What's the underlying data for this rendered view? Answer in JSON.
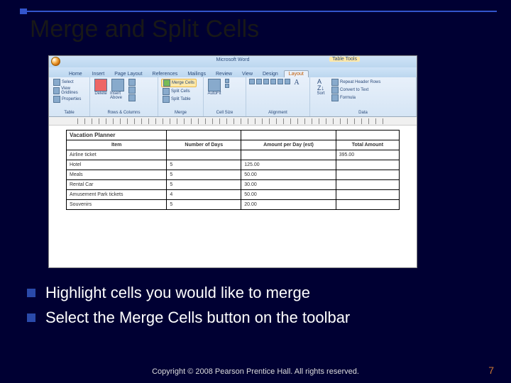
{
  "slide": {
    "title": "Merge and Split Cells",
    "bullets": [
      "Highlight cells you would like to merge",
      "Select the Merge Cells button on the toolbar"
    ],
    "copyright": "Copyright © 2008 Pearson Prentice Hall. All rights reserved.",
    "page_number": "7"
  },
  "word": {
    "app_title": "Microsoft Word",
    "context_tab_group": "Table Tools",
    "tabs": [
      "Home",
      "Insert",
      "Page Layout",
      "References",
      "Mailings",
      "Review",
      "View",
      "Design",
      "Layout"
    ],
    "active_tab": "Layout",
    "groups": {
      "table": {
        "label": "Table",
        "items": [
          "Select",
          "View Gridlines",
          "Properties"
        ]
      },
      "rows_columns": {
        "label": "Rows & Columns",
        "delete": "Delete",
        "insert_above": "Insert Above",
        "insert_below": "Insert Below",
        "insert_left": "Insert Left",
        "insert_right": "Insert Right"
      },
      "merge": {
        "label": "Merge",
        "merge_cells": "Merge Cells",
        "split_cells": "Split Cells",
        "split_table": "Split Table"
      },
      "cell_size": {
        "label": "Cell Size",
        "autofit": "AutoFit"
      },
      "alignment": {
        "label": "Alignment"
      },
      "data": {
        "label": "Data",
        "sort": "Sort",
        "repeat_header": "Repeat Header Rows",
        "convert": "Convert to Text",
        "formula": "Formula"
      }
    },
    "table_data": {
      "title": "Vacation Planner",
      "headers": [
        "Item",
        "Number of Days",
        "Amount per Day (est)",
        "Total Amount"
      ],
      "rows": [
        [
          "Airline ticket",
          "",
          "",
          "395.00"
        ],
        [
          "Hotel",
          "5",
          "125.00",
          ""
        ],
        [
          "Meals",
          "5",
          "50.00",
          ""
        ],
        [
          "Rental Car",
          "5",
          "30.00",
          ""
        ],
        [
          "Amusement Park tickets",
          "4",
          "50.00",
          ""
        ],
        [
          "Souvenirs",
          "5",
          "20.00",
          ""
        ]
      ]
    }
  }
}
